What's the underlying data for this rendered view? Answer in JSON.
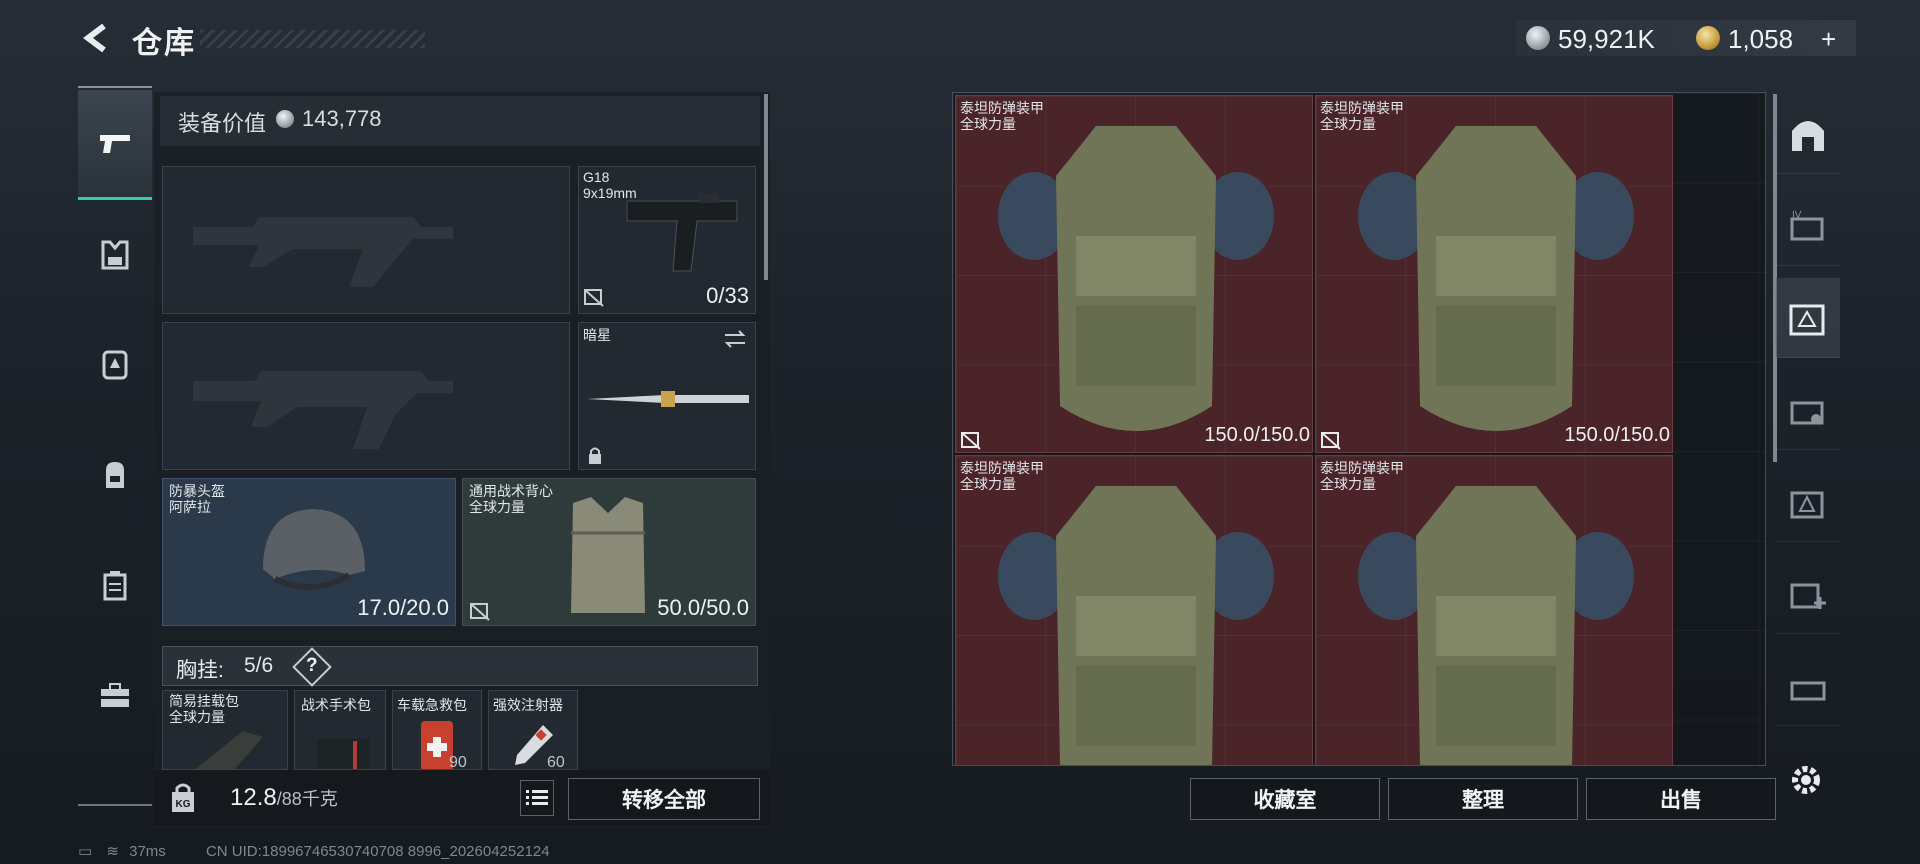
{
  "header": {
    "title": "仓库"
  },
  "currency": [
    {
      "value": "59,921K",
      "icon": "silver-coin-icon"
    },
    {
      "value": "1,058",
      "plus": "+",
      "icon": "gold-coin-icon"
    }
  ],
  "left_nav": [
    "pistol-icon",
    "backpack-armor-icon",
    "rig-icon",
    "bag-icon",
    "case-icon",
    "toolbox-icon"
  ],
  "equipment": {
    "value_label": "装备价值",
    "value": "143,778",
    "pistol": {
      "name": "G18",
      "caliber": "9x19mm",
      "ammo": "0/33"
    },
    "melee": {
      "name": "暗星"
    },
    "helmet": {
      "name": "防暴头盔",
      "brand": "阿萨拉",
      "durability": "17.0/20.0"
    },
    "vest": {
      "name": "通用战术背心",
      "brand": "全球力量",
      "durability": "50.0/50.0"
    }
  },
  "chest_rig": {
    "label": "胸挂:",
    "count": "5/6",
    "help": "?",
    "items": [
      {
        "name": "简易挂载包",
        "brand": "全球力量"
      },
      {
        "name": "战术手术包",
        "count": ""
      },
      {
        "name": "车载急救包",
        "count": "90"
      },
      {
        "name": "强效注射器",
        "count": "60"
      }
    ]
  },
  "weight": {
    "current": "12.8",
    "max": "/88千克"
  },
  "buttons": {
    "transfer_all": "转移全部",
    "collection": "收藏室",
    "organize": "整理",
    "sell": "出售"
  },
  "storage": {
    "items": [
      {
        "name": "泰坦防弹装甲",
        "brand": "全球力量",
        "durability": "150.0/150.0"
      },
      {
        "name": "泰坦防弹装甲",
        "brand": "全球力量",
        "durability": "150.0/150.0"
      },
      {
        "name": "泰坦防弹装甲",
        "brand": "全球力量"
      },
      {
        "name": "泰坦防弹装甲",
        "brand": "全球力量"
      }
    ]
  },
  "status": {
    "ping": "37ms",
    "uid": "CN UID:18996746530740708 8996_202604252124"
  }
}
